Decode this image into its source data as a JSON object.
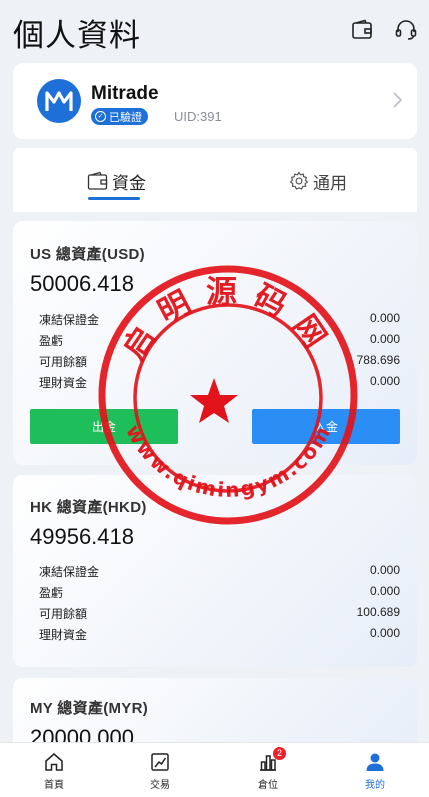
{
  "header": {
    "title": "個人資料",
    "icons": [
      "wallet-icon",
      "headset-support-icon"
    ]
  },
  "profile": {
    "name": "Mitrade",
    "verified_label": "已驗證",
    "uid": "UID:391"
  },
  "tabs": [
    {
      "label": "資金",
      "icon": "wallet-icon",
      "active": true
    },
    {
      "label": "通用",
      "icon": "gear-icon",
      "active": false
    }
  ],
  "accounts": [
    {
      "title": "US 總資產(USD)",
      "total": "50006.418",
      "rows": [
        {
          "label": "凍結保證金",
          "value": "0.000"
        },
        {
          "label": "盈虧",
          "value": "0.000"
        },
        {
          "label": "可用餘額",
          "value": "788.696"
        },
        {
          "label": "理財資金",
          "value": "0.000"
        }
      ],
      "withdraw_label": "出金",
      "deposit_label": "入金"
    },
    {
      "title": "HK 總資產(HKD)",
      "total": "49956.418",
      "rows": [
        {
          "label": "凍結保證金",
          "value": "0.000"
        },
        {
          "label": "盈虧",
          "value": "0.000"
        },
        {
          "label": "可用餘額",
          "value": "100.689"
        },
        {
          "label": "理財資金",
          "value": "0.000"
        }
      ]
    },
    {
      "title": "MY 總資產(MYR)",
      "total": "20000.000"
    }
  ],
  "watermark": {
    "text_top": "启明源码网",
    "text_bottom": "www.qimingym.com",
    "color": "#e2131a"
  },
  "tabbar": [
    {
      "label": "首頁",
      "icon": "home-icon",
      "active": false
    },
    {
      "label": "交易",
      "icon": "trade-chart-icon",
      "active": false
    },
    {
      "label": "倉位",
      "icon": "positions-bar-icon",
      "active": false,
      "badge": "2"
    },
    {
      "label": "我的",
      "icon": "user-icon",
      "active": true
    }
  ],
  "colors": {
    "accent": "#1f6fd8",
    "withdraw": "#1ebe5a",
    "deposit": "#2a8ef5",
    "badge": "#e8202a"
  }
}
